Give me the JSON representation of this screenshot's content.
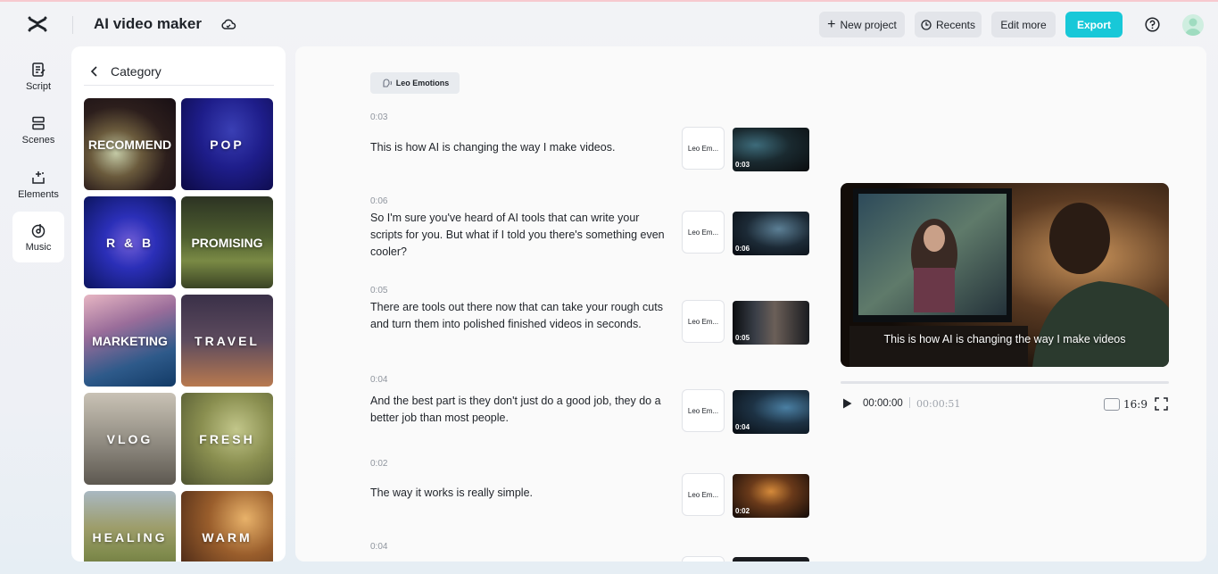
{
  "header": {
    "title": "AI video maker",
    "new_project": "New project",
    "recents": "Recents",
    "edit_more": "Edit more",
    "export": "Export",
    "accent_color": "#18c8d8"
  },
  "rail": {
    "items": [
      {
        "label": "Script",
        "icon": "script-icon"
      },
      {
        "label": "Scenes",
        "icon": "scenes-icon"
      },
      {
        "label": "Elements",
        "icon": "elements-icon"
      },
      {
        "label": "Music",
        "icon": "music-icon",
        "active": true
      }
    ]
  },
  "category": {
    "title": "Category",
    "tiles": [
      "RECOMMEND",
      "POP",
      "R & B",
      "PROMISING",
      "MARKETING",
      "TRAVEL",
      "VLOG",
      "FRESH",
      "HEALING",
      "WARM"
    ]
  },
  "script": {
    "voice_chip": "Leo Emotions",
    "segments": [
      {
        "time": "0:03",
        "text": "This is how AI is changing the way I make videos.",
        "voice": "Leo Em...",
        "duration": "0:03"
      },
      {
        "time": "0:06",
        "text": "So I'm sure you've heard of AI tools that can write your scripts for you. But what if I told you there's something even cooler?",
        "voice": "Leo Em...",
        "duration": "0:06"
      },
      {
        "time": "0:05",
        "text": "There are tools out there now that can take your rough cuts and turn them into polished finished videos in seconds.",
        "voice": "Leo Em...",
        "duration": "0:05"
      },
      {
        "time": "0:04",
        "text": "And the best part is they don't just do a good job, they do a better job than most people.",
        "voice": "Leo Em...",
        "duration": "0:04"
      },
      {
        "time": "0:02",
        "text": "The way it works is really simple.",
        "voice": "Leo Em...",
        "duration": "0:02"
      },
      {
        "time": "0:04",
        "text": "",
        "voice": "",
        "duration": ""
      }
    ]
  },
  "preview": {
    "caption": "This is how AI is changing the way I make videos",
    "current_time": "00:00:00",
    "total_time": "00:00:51",
    "progress": 0,
    "aspect_ratio": "16:9"
  }
}
